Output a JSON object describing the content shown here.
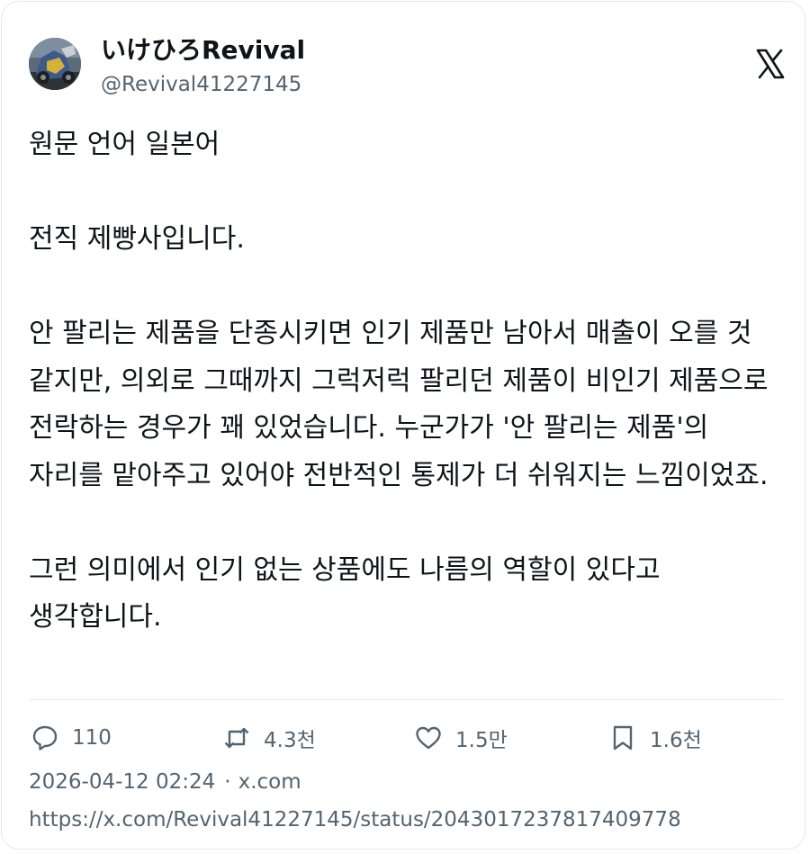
{
  "author": {
    "display_name": "いけひろRevival",
    "handle": "@Revival41227145"
  },
  "icons": {
    "logo": "x-logo-icon",
    "reply": "reply-icon",
    "repost": "repost-icon",
    "like": "heart-icon",
    "bookmark": "bookmark-icon"
  },
  "tweet": {
    "text": "원문 언어 일본어\n\n전직 제빵사입니다.\n\n안 팔리는 제품을 단종시키면 인기 제품만 남아서 매출이 오를 것 같지만, 의외로 그때까지 그럭저럭 팔리던 제품이 비인기 제품으로 전락하는 경우가 꽤 있었습니다. 누군가가 '안 팔리는 제품'의 자리를 맡아주고 있어야 전반적인 통제가 더 쉬워지는 느낌이었죠.\n\n그런 의미에서 인기 없는 상품에도 나름의 역할이 있다고 생각합니다."
  },
  "stats": {
    "replies": "110",
    "reposts": "4.3천",
    "likes": "1.5만",
    "bookmarks": "1.6천"
  },
  "meta": {
    "timestamp": "2026-04-12 02:24",
    "separator": "·",
    "source": "x.com",
    "url": "https://x.com/Revival41227145/status/2043017237817409778"
  },
  "colors": {
    "text_primary": "#0f1419",
    "text_secondary": "#536471",
    "border": "#e6e9ec"
  }
}
